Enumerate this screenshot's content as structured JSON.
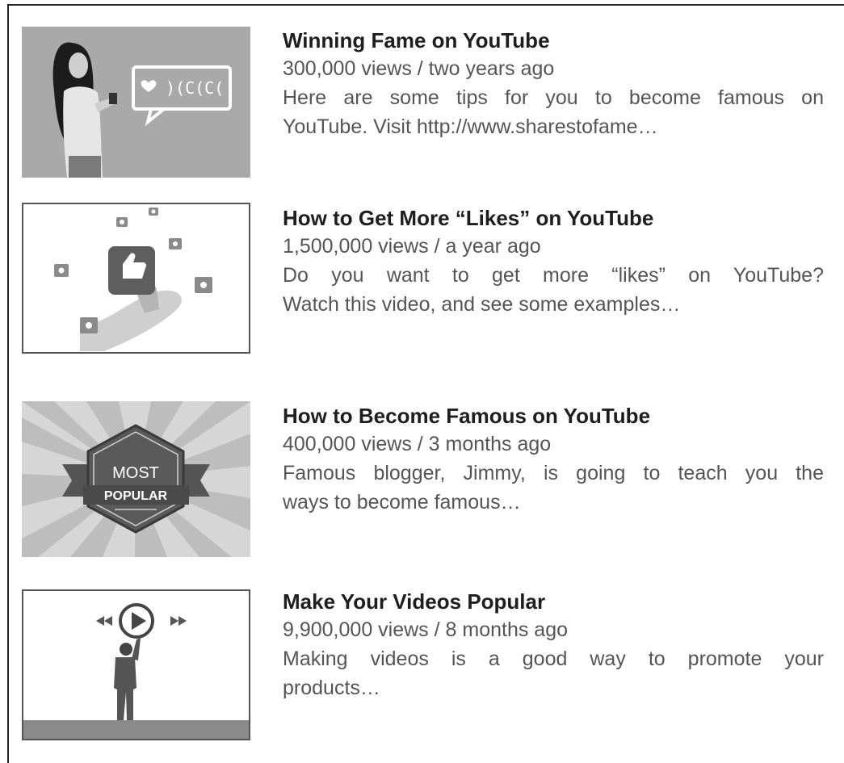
{
  "videos": [
    {
      "title": "Winning Fame on YouTube",
      "meta": "300,000 views / two years ago",
      "desc_line1": "Here are some tips for you to become famous on",
      "desc_line2": "YouTube. Visit http://www.sharestofame…",
      "thumb_icon": "woman-with-heart-speech-bubble"
    },
    {
      "title": "How to Get More “Likes” on YouTube",
      "meta": "1,500,000 views / a year ago",
      "desc_line1": "Do you want to get more “likes” on YouTube?",
      "desc_line2": "Watch this video, and see some examples…",
      "thumb_icon": "hand-thumbs-up-likes"
    },
    {
      "title": "How to Become Famous on YouTube",
      "meta": "400,000 views / 3 months ago",
      "desc_line1": "Famous blogger, Jimmy, is going to teach you the",
      "desc_line2": "ways to become famous…",
      "thumb_icon": "most-popular-badge",
      "badge_line1": "MOST",
      "badge_line2": "POPULAR"
    },
    {
      "title": "Make Your Videos Popular",
      "meta": "9,900,000 views / 8 months ago",
      "desc_line1": "Making videos is a good way to promote your",
      "desc_line2": "products…",
      "thumb_icon": "man-touching-play-button"
    }
  ],
  "colors": {
    "title": "#1e1e1e",
    "meta": "#555555",
    "thumb_gray": "#a9a9a9"
  }
}
